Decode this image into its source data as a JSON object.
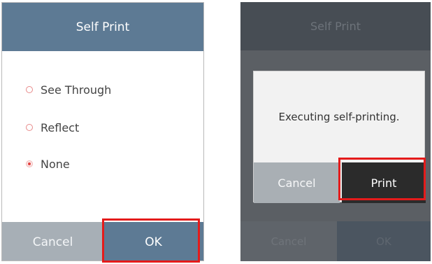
{
  "left_screen": {
    "title": "Self Print",
    "options": [
      {
        "label": "See Through",
        "selected": false
      },
      {
        "label": "Reflect",
        "selected": false
      },
      {
        "label": "None",
        "selected": true
      }
    ],
    "cancel_label": "Cancel",
    "ok_label": "OK"
  },
  "right_screen": {
    "title": "Self Print",
    "dialog": {
      "message": "Executing self-printing.",
      "cancel_label": "Cancel",
      "print_label": "Print"
    },
    "cancel_label": "Cancel",
    "ok_label": "OK"
  },
  "colors": {
    "titlebar": "#5d7a94",
    "highlight": "#e41b1b",
    "radio_selected": "#e3413f"
  }
}
